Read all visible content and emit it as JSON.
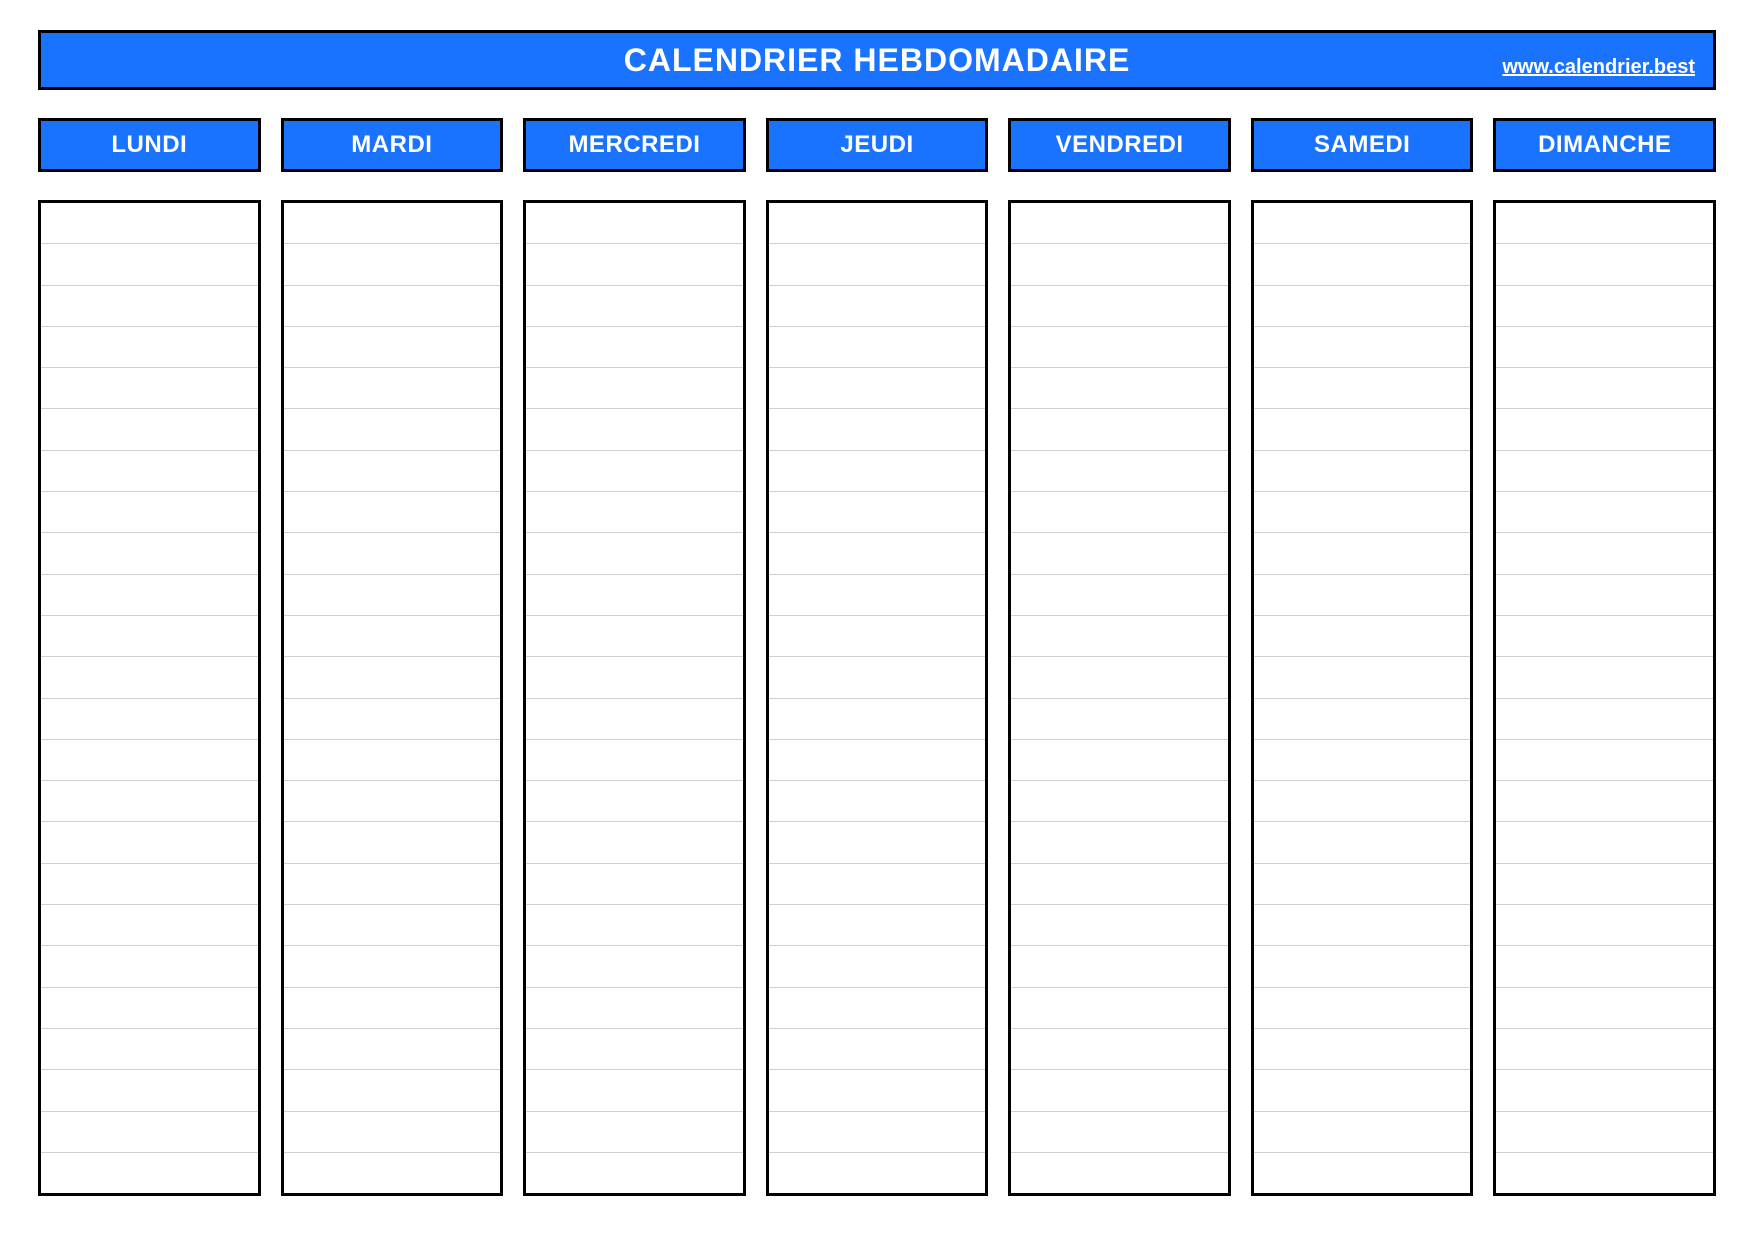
{
  "header": {
    "title": "CALENDRIER HEBDOMADAIRE",
    "link_label": "www.calendrier.best"
  },
  "rows_per_day": 24,
  "days": [
    {
      "label": "LUNDI",
      "entries": [
        "",
        "",
        "",
        "",
        "",
        "",
        "",
        "",
        "",
        "",
        "",
        "",
        "",
        "",
        "",
        "",
        "",
        "",
        "",
        "",
        "",
        "",
        "",
        ""
      ]
    },
    {
      "label": "MARDI",
      "entries": [
        "",
        "",
        "",
        "",
        "",
        "",
        "",
        "",
        "",
        "",
        "",
        "",
        "",
        "",
        "",
        "",
        "",
        "",
        "",
        "",
        "",
        "",
        "",
        ""
      ]
    },
    {
      "label": "MERCREDI",
      "entries": [
        "",
        "",
        "",
        "",
        "",
        "",
        "",
        "",
        "",
        "",
        "",
        "",
        "",
        "",
        "",
        "",
        "",
        "",
        "",
        "",
        "",
        "",
        "",
        ""
      ]
    },
    {
      "label": "JEUDI",
      "entries": [
        "",
        "",
        "",
        "",
        "",
        "",
        "",
        "",
        "",
        "",
        "",
        "",
        "",
        "",
        "",
        "",
        "",
        "",
        "",
        "",
        "",
        "",
        "",
        ""
      ]
    },
    {
      "label": "VENDREDI",
      "entries": [
        "",
        "",
        "",
        "",
        "",
        "",
        "",
        "",
        "",
        "",
        "",
        "",
        "",
        "",
        "",
        "",
        "",
        "",
        "",
        "",
        "",
        "",
        "",
        ""
      ]
    },
    {
      "label": "SAMEDI",
      "entries": [
        "",
        "",
        "",
        "",
        "",
        "",
        "",
        "",
        "",
        "",
        "",
        "",
        "",
        "",
        "",
        "",
        "",
        "",
        "",
        "",
        "",
        "",
        "",
        ""
      ]
    },
    {
      "label": "DIMANCHE",
      "entries": [
        "",
        "",
        "",
        "",
        "",
        "",
        "",
        "",
        "",
        "",
        "",
        "",
        "",
        "",
        "",
        "",
        "",
        "",
        "",
        "",
        "",
        "",
        "",
        ""
      ]
    }
  ],
  "colors": {
    "accent": "#1a73ff",
    "border": "#000000",
    "rule": "#cfcfcf",
    "text_on_accent": "#ffffff"
  }
}
